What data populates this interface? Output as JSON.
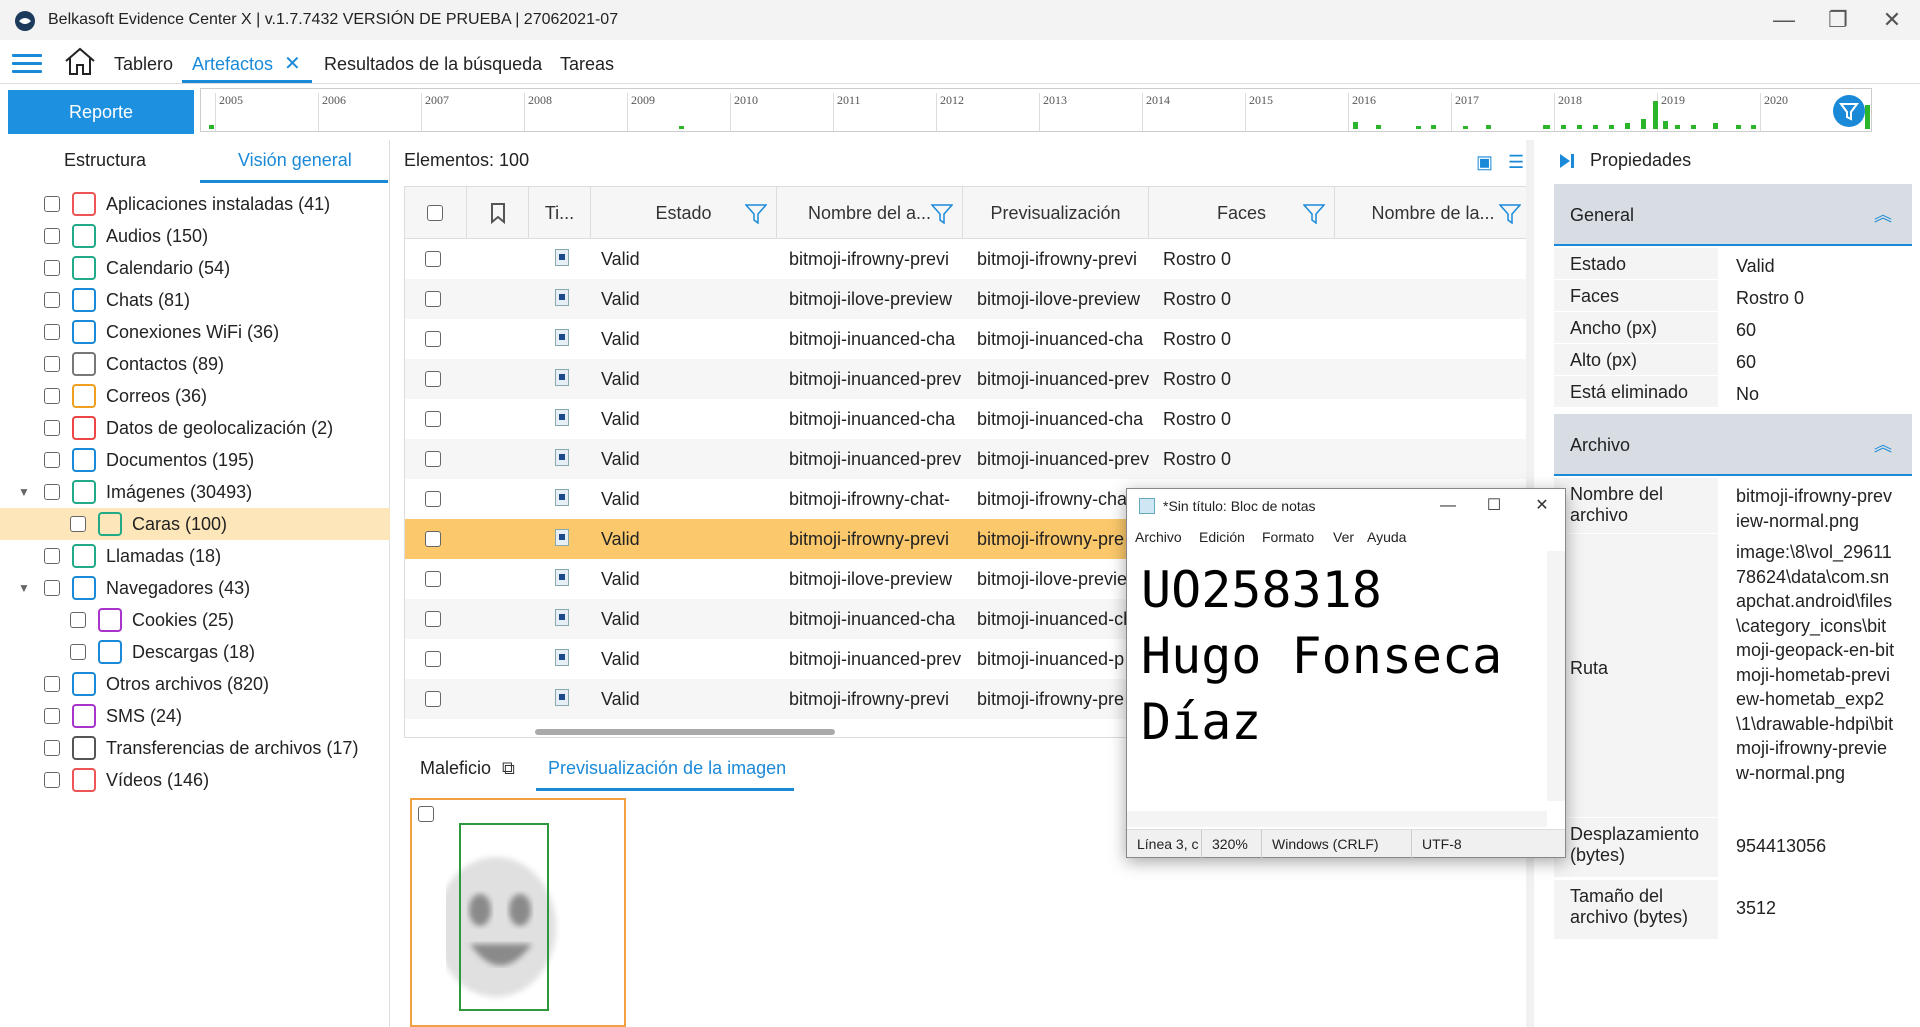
{
  "window": {
    "title": "Belkasoft Evidence Center X | v.1.7.7432 VERSIÓN DE PRUEBA | 27062021-07"
  },
  "nav": {
    "tabs": [
      "Tablero",
      "Artefactos",
      "Resultados de la búsqueda",
      "Tareas"
    ]
  },
  "report_button": "Reporte",
  "timeline": {
    "years": [
      "2005",
      "2006",
      "2007",
      "2008",
      "2009",
      "2010",
      "2011",
      "2012",
      "2013",
      "2014",
      "2015",
      "2016",
      "2017",
      "2018",
      "2019",
      "2020"
    ]
  },
  "left_panel": {
    "tabs": [
      "Estructura",
      "Visión general"
    ],
    "tree": [
      {
        "label": "Aplicaciones instaladas (41)",
        "icon": "app-icon"
      },
      {
        "label": "Audios (150)",
        "icon": "speaker-icon"
      },
      {
        "label": "Calendario (54)",
        "icon": "calendar-icon"
      },
      {
        "label": "Chats (81)",
        "icon": "chat-icon"
      },
      {
        "label": "Conexiones WiFi (36)",
        "icon": "wifi-icon"
      },
      {
        "label": "Contactos (89)",
        "icon": "contact-icon"
      },
      {
        "label": "Correos (36)",
        "icon": "at-icon"
      },
      {
        "label": "Datos de geolocalización (2)",
        "icon": "geolocation-icon"
      },
      {
        "label": "Documentos (195)",
        "icon": "document-icon"
      },
      {
        "label": "Imágenes (30493)",
        "icon": "image-icon"
      },
      {
        "label": "Caras (100)",
        "icon": "face-image-icon"
      },
      {
        "label": "Llamadas (18)",
        "icon": "phone-icon"
      },
      {
        "label": "Navegadores (43)",
        "icon": "globe-icon"
      },
      {
        "label": "Cookies (25)",
        "icon": "cookie-icon"
      },
      {
        "label": "Descargas (18)",
        "icon": "download-icon"
      },
      {
        "label": "Otros archivos (820)",
        "icon": "file-icon"
      },
      {
        "label": "SMS (24)",
        "icon": "sms-icon"
      },
      {
        "label": "Transferencias de archivos (17)",
        "icon": "transfer-icon"
      },
      {
        "label": "Vídeos (146)",
        "icon": "video-icon"
      }
    ]
  },
  "grid": {
    "count_label": "Elementos: 100",
    "headers": [
      "Ti...",
      "Estado",
      "Nombre del a...",
      "Previsualización",
      "Faces",
      "Nombre de la..."
    ],
    "rows": [
      {
        "estado": "Valid",
        "nombre": "bitmoji-ifrowny-previ",
        "prev": "bitmoji-ifrowny-previ",
        "faces": "Rostro 0"
      },
      {
        "estado": "Valid",
        "nombre": "bitmoji-ilove-preview",
        "prev": "bitmoji-ilove-preview",
        "faces": "Rostro 0"
      },
      {
        "estado": "Valid",
        "nombre": "bitmoji-inuanced-cha",
        "prev": "bitmoji-inuanced-cha",
        "faces": "Rostro 0"
      },
      {
        "estado": "Valid",
        "nombre": "bitmoji-inuanced-prev",
        "prev": "bitmoji-inuanced-prev",
        "faces": "Rostro 0"
      },
      {
        "estado": "Valid",
        "nombre": "bitmoji-inuanced-cha",
        "prev": "bitmoji-inuanced-cha",
        "faces": "Rostro 0"
      },
      {
        "estado": "Valid",
        "nombre": "bitmoji-inuanced-prev",
        "prev": "bitmoji-inuanced-prev",
        "faces": "Rostro 0"
      },
      {
        "estado": "Valid",
        "nombre": "bitmoji-ifrowny-chat-",
        "prev": "bitmoji-ifrowny-cha",
        "faces": ""
      },
      {
        "estado": "Valid",
        "nombre": "bitmoji-ifrowny-previ",
        "prev": "bitmoji-ifrowny-pre",
        "faces": ""
      },
      {
        "estado": "Valid",
        "nombre": "bitmoji-ilove-preview",
        "prev": "bitmoji-ilove-previe",
        "faces": ""
      },
      {
        "estado": "Valid",
        "nombre": "bitmoji-inuanced-cha",
        "prev": "bitmoji-inuanced-ch",
        "faces": ""
      },
      {
        "estado": "Valid",
        "nombre": "bitmoji-inuanced-prev",
        "prev": "bitmoji-inuanced-p",
        "faces": ""
      },
      {
        "estado": "Valid",
        "nombre": "bitmoji-ifrowny-previ",
        "prev": "bitmoji-ifrowny-pre",
        "faces": ""
      }
    ]
  },
  "bottom_tabs": [
    "Maleficio",
    "Previsualización de la imagen"
  ],
  "properties": {
    "title": "Propiedades",
    "sections": [
      {
        "name": "General",
        "rows": [
          {
            "k": "Estado",
            "v": "Valid"
          },
          {
            "k": "Faces",
            "v": "Rostro 0"
          },
          {
            "k": "Ancho (px)",
            "v": "60"
          },
          {
            "k": "Alto (px)",
            "v": "60"
          },
          {
            "k": "Está eliminado",
            "v": "No"
          }
        ]
      },
      {
        "name": "Archivo",
        "rows": [
          {
            "k": "Nombre del archivo",
            "v": "bitmoji-ifrowny-preview-normal.png"
          },
          {
            "k": "Ruta",
            "v": "image:\\8\\vol_2961178624\\data\\com.snapchat.android\\files\\category_icons\\bitmoji-geopack-en-bitmoji-hometab-preview-hometab_exp2\\1\\drawable-hdpi\\bitmoji-ifrowny-preview-normal.png"
          },
          {
            "k": "Desplazamiento (bytes)",
            "v": "954413056"
          },
          {
            "k": "Tamaño del archivo (bytes)",
            "v": "3512"
          }
        ]
      }
    ]
  },
  "notepad": {
    "title": "*Sin título: Bloc de notas",
    "menu": [
      "Archivo",
      "Edición",
      "Formato",
      "Ver",
      "Ayuda"
    ],
    "text": "UO258318\nHugo Fonseca\nDíaz",
    "status": {
      "pos": "Línea 3, c",
      "zoom": "320%",
      "eol": "Windows (CRLF)",
      "enc": "UTF-8"
    }
  },
  "colors": {
    "accent": "#1a8ad8",
    "selected_row": "#fbc96b",
    "tree_selected": "#fde6b9",
    "timeline_bar": "#2bb52b"
  }
}
